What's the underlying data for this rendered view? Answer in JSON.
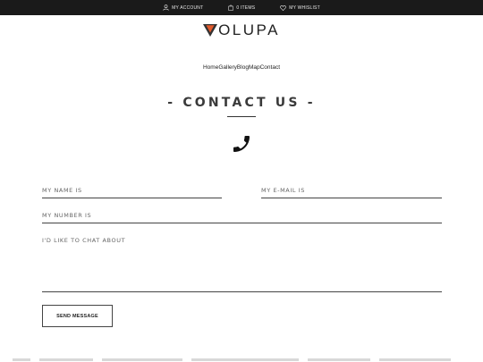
{
  "topbar": {
    "account_label": "MY ACCOUNT",
    "cart_label": "0 ITEMS",
    "wishlist_label": "MY WHISLIST"
  },
  "logo": {
    "rest": "OLUPA",
    "accent_color": "#e25a2b"
  },
  "nav": {
    "items": [
      {
        "label": "Home"
      },
      {
        "label": "Gallery"
      },
      {
        "label": "Blog"
      },
      {
        "label": "Map"
      },
      {
        "label": "Contact"
      }
    ]
  },
  "page": {
    "title": "- CONTACT US -"
  },
  "form": {
    "name_label": "MY NAME IS",
    "email_label": "MY E-MAIL IS",
    "number_label": "MY NUMBER IS",
    "chat_label": "I'D LIKE TO CHAT ABOUT",
    "send_label": "SEND MESSAGE"
  }
}
